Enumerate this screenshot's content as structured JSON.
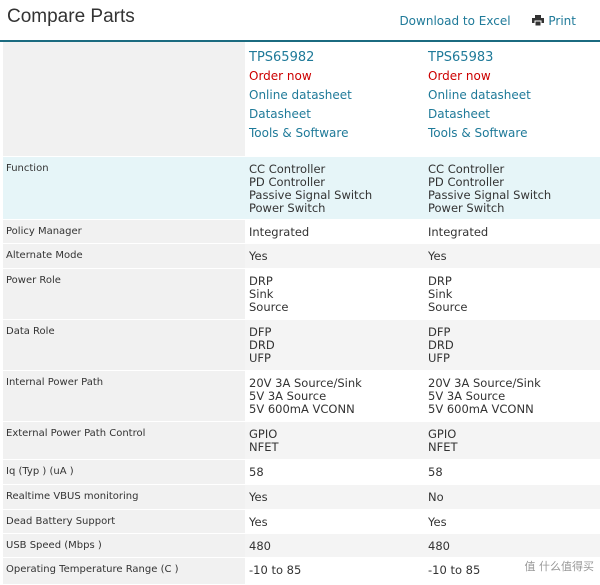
{
  "header": {
    "title": "Compare Parts",
    "download_label": "Download to Excel",
    "print_label": "Print",
    "print_icon": "printer-icon"
  },
  "parts": [
    {
      "name": "TPS65982",
      "order": "Order now",
      "online": "Online datasheet",
      "datasheet": "Datasheet",
      "tools": "Tools & Software"
    },
    {
      "name": "TPS65983",
      "order": "Order now",
      "online": "Online datasheet",
      "datasheet": "Datasheet",
      "tools": "Tools & Software"
    }
  ],
  "rows": [
    {
      "label": "Function",
      "values": [
        [
          "CC Controller",
          "PD Controller",
          "Passive Signal Switch",
          "Power Switch"
        ],
        [
          "CC Controller",
          "PD Controller",
          "Passive Signal Switch",
          "Power Switch"
        ]
      ]
    },
    {
      "label": "Policy Manager",
      "values": [
        [
          "Integrated"
        ],
        [
          "Integrated"
        ]
      ]
    },
    {
      "label": "Alternate Mode",
      "values": [
        [
          "Yes"
        ],
        [
          "Yes"
        ]
      ]
    },
    {
      "label": "Power Role",
      "values": [
        [
          "DRP",
          "Sink",
          "Source"
        ],
        [
          "DRP",
          "Sink",
          "Source"
        ]
      ]
    },
    {
      "label": "Data Role",
      "values": [
        [
          "DFP",
          "DRD",
          "UFP"
        ],
        [
          "DFP",
          "DRD",
          "UFP"
        ]
      ]
    },
    {
      "label": "Internal Power Path",
      "values": [
        [
          "20V 3A Source/Sink",
          "5V 3A Source",
          "5V 600mA VCONN"
        ],
        [
          "20V 3A Source/Sink",
          "5V 3A Source",
          "5V 600mA VCONN"
        ]
      ]
    },
    {
      "label": "External Power Path Control",
      "values": [
        [
          "GPIO",
          "NFET"
        ],
        [
          "GPIO",
          "NFET"
        ]
      ]
    },
    {
      "label": "Iq (Typ ) (uA )",
      "values": [
        [
          "58"
        ],
        [
          "58"
        ]
      ]
    },
    {
      "label": "Realtime VBUS monitoring",
      "values": [
        [
          "Yes"
        ],
        [
          "No"
        ]
      ]
    },
    {
      "label": "Dead Battery Support",
      "values": [
        [
          "Yes"
        ],
        [
          "Yes"
        ]
      ]
    },
    {
      "label": "USB Speed (Mbps )",
      "values": [
        [
          "480"
        ],
        [
          "480"
        ]
      ]
    },
    {
      "label": "Operating Temperature Range (C )",
      "values": [
        [
          "-10 to 85"
        ],
        [
          "-10 to 85"
        ]
      ]
    }
  ],
  "watermark": "值 什么值得买"
}
